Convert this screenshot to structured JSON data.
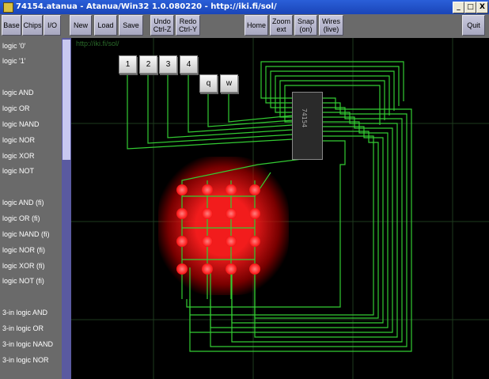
{
  "window": {
    "title": "74154.atanua - Atanua/Win32 1.0.080220 - http://iki.fi/sol/",
    "controls": [
      "_",
      "□",
      "X"
    ]
  },
  "toolbar": {
    "buttons": [
      {
        "label": "Base"
      },
      {
        "label": "Chips"
      },
      {
        "label": "I/O"
      },
      {
        "label": "New"
      },
      {
        "label": "Load"
      },
      {
        "label": "Save"
      },
      {
        "label": "Undo\nCtrl-Z"
      },
      {
        "label": "Redo\nCtrl-Y"
      },
      {
        "label": "Home"
      },
      {
        "label": "Zoom\next"
      },
      {
        "label": "Snap\n(on)"
      },
      {
        "label": "Wires\n(live)"
      },
      {
        "label": "Quit"
      }
    ]
  },
  "sidebar": {
    "items": [
      "logic '0'",
      "logic '1'",
      "logic AND",
      "logic OR",
      "logic NAND",
      "logic NOR",
      "logic XOR",
      "logic NOT",
      "logic AND (fi)",
      "logic OR (fi)",
      "logic NAND (fi)",
      "logic NOR (fi)",
      "logic XOR (fi)",
      "logic NOT (fi)",
      "3-in logic AND",
      "3-in logic OR",
      "3-in logic NAND",
      "3-in logic NOR"
    ]
  },
  "canvas": {
    "url_watermark": "http://iki.fi/sol/",
    "keys": [
      "1",
      "2",
      "3",
      "4",
      "q",
      "w"
    ],
    "chip_label": "74154",
    "wire_color": "#33cc33",
    "led_color": "#ff2020",
    "grid_color": "#1e3a1e"
  }
}
